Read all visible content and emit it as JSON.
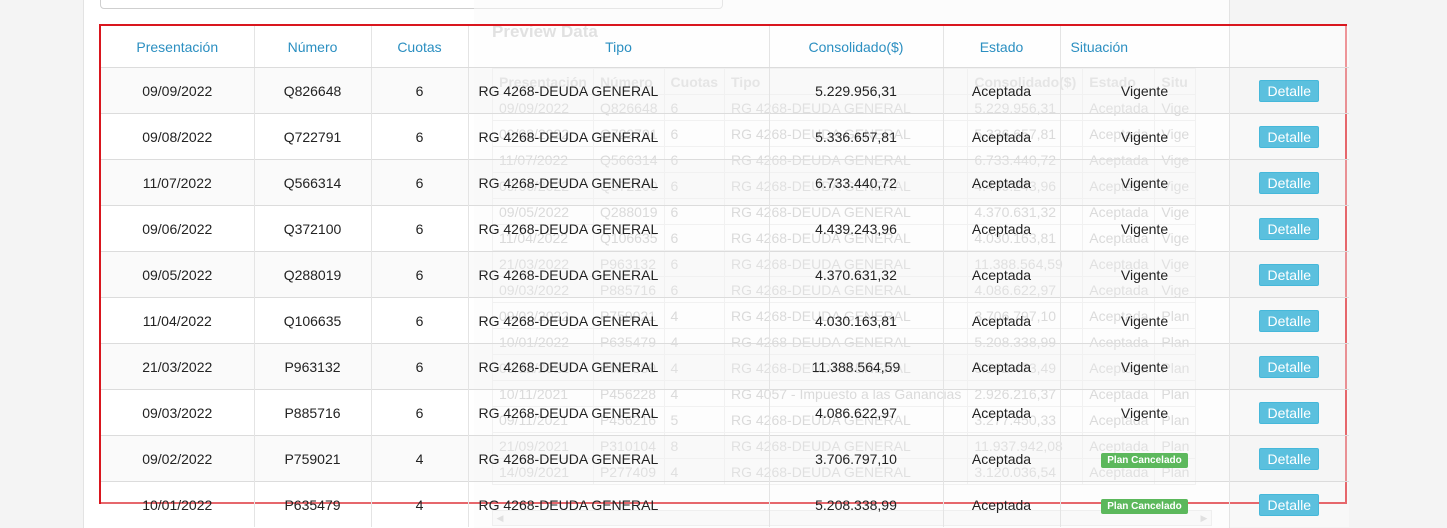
{
  "preview": {
    "title": "Preview Data",
    "headers": [
      "Presentación",
      "Número",
      "Cuotas",
      "Tipo",
      "Consolidado($)",
      "Estado",
      "Situ"
    ],
    "rows": [
      [
        "09/09/2022",
        "Q826648",
        "6",
        "RG 4268-DEUDA GENERAL",
        "5.229.956,31",
        "Aceptada",
        "Vige"
      ],
      [
        "09/08/2022",
        "Q722791",
        "6",
        "RG 4268-DEUDA GENERAL",
        "5.336.657,81",
        "Aceptada",
        "Vige"
      ],
      [
        "11/07/2022",
        "Q566314",
        "6",
        "RG 4268-DEUDA GENERAL",
        "6.733.440,72",
        "Aceptada",
        "Vige"
      ],
      [
        "09/06/2022",
        "Q372100",
        "6",
        "RG 4268-DEUDA GENERAL",
        "4.439.243,96",
        "Aceptada",
        "Vige"
      ],
      [
        "09/05/2022",
        "Q288019",
        "6",
        "RG 4268-DEUDA GENERAL",
        "4.370.631,32",
        "Aceptada",
        "Vige"
      ],
      [
        "11/04/2022",
        "Q106635",
        "6",
        "RG 4268-DEUDA GENERAL",
        "4.030.163,81",
        "Aceptada",
        "Vige"
      ],
      [
        "21/03/2022",
        "P963132",
        "6",
        "RG 4268-DEUDA GENERAL",
        "11.388.564,59",
        "Aceptada",
        "Vige"
      ],
      [
        "09/03/2022",
        "P885716",
        "6",
        "RG 4268-DEUDA GENERAL",
        "4.086.622,97",
        "Aceptada",
        "Vige"
      ],
      [
        "09/02/2022",
        "P759021",
        "4",
        "RG 4268-DEUDA GENERAL",
        "3.706.797,10",
        "Aceptada",
        "Plan"
      ],
      [
        "10/01/2022",
        "P635479",
        "4",
        "RG 4268-DEUDA GENERAL",
        "5.208.338,99",
        "Aceptada",
        "Plan"
      ],
      [
        "09/12/2021",
        "P527389",
        "4",
        "RG 4268-DEUDA GENERAL",
        "3.162.473,49",
        "Aceptada",
        "Plan"
      ],
      [
        "10/11/2021",
        "P456228",
        "4",
        "RG 4057 - Impuesto a las Ganancias",
        "2.926.216,37",
        "Aceptada",
        "Plan"
      ],
      [
        "09/11/2021",
        "P456216",
        "5",
        "RG 4268-DEUDA GENERAL",
        "3.277.450,33",
        "Aceptada",
        "Plan"
      ],
      [
        "21/09/2021",
        "P310104",
        "8",
        "RG 4268-DEUDA GENERAL",
        "11.937.942,08",
        "Aceptada",
        "Plan"
      ],
      [
        "14/09/2021",
        "P277409",
        "4",
        "RG 4268-DEUDA GENERAL",
        "3.120.036,54",
        "Aceptada",
        "Plan"
      ]
    ]
  },
  "table": {
    "headers": {
      "presentacion": "Presentación",
      "numero": "Número",
      "cuotas": "Cuotas",
      "tipo": "Tipo",
      "consolidado": "Consolidado($)",
      "estado": "Estado",
      "situacion": "Situación"
    },
    "detail_label": "Detalle",
    "rows": [
      {
        "presentacion": "09/09/2022",
        "numero": "Q826648",
        "cuotas": "6",
        "tipo": "RG 4268-DEUDA GENERAL",
        "consolidado": "5.229.956,31",
        "estado": "Aceptada",
        "situacion": "Vigente",
        "badge": false
      },
      {
        "presentacion": "09/08/2022",
        "numero": "Q722791",
        "cuotas": "6",
        "tipo": "RG 4268-DEUDA GENERAL",
        "consolidado": "5.336.657,81",
        "estado": "Aceptada",
        "situacion": "Vigente",
        "badge": false
      },
      {
        "presentacion": "11/07/2022",
        "numero": "Q566314",
        "cuotas": "6",
        "tipo": "RG 4268-DEUDA GENERAL",
        "consolidado": "6.733.440,72",
        "estado": "Aceptada",
        "situacion": "Vigente",
        "badge": false
      },
      {
        "presentacion": "09/06/2022",
        "numero": "Q372100",
        "cuotas": "6",
        "tipo": "RG 4268-DEUDA GENERAL",
        "consolidado": "4.439.243,96",
        "estado": "Aceptada",
        "situacion": "Vigente",
        "badge": false
      },
      {
        "presentacion": "09/05/2022",
        "numero": "Q288019",
        "cuotas": "6",
        "tipo": "RG 4268-DEUDA GENERAL",
        "consolidado": "4.370.631,32",
        "estado": "Aceptada",
        "situacion": "Vigente",
        "badge": false
      },
      {
        "presentacion": "11/04/2022",
        "numero": "Q106635",
        "cuotas": "6",
        "tipo": "RG 4268-DEUDA GENERAL",
        "consolidado": "4.030.163,81",
        "estado": "Aceptada",
        "situacion": "Vigente",
        "badge": false
      },
      {
        "presentacion": "21/03/2022",
        "numero": "P963132",
        "cuotas": "6",
        "tipo": "RG 4268-DEUDA GENERAL",
        "consolidado": "11.388.564,59",
        "estado": "Aceptada",
        "situacion": "Vigente",
        "badge": false
      },
      {
        "presentacion": "09/03/2022",
        "numero": "P885716",
        "cuotas": "6",
        "tipo": "RG 4268-DEUDA GENERAL",
        "consolidado": "4.086.622,97",
        "estado": "Aceptada",
        "situacion": "Vigente",
        "badge": false
      },
      {
        "presentacion": "09/02/2022",
        "numero": "P759021",
        "cuotas": "4",
        "tipo": "RG 4268-DEUDA GENERAL",
        "consolidado": "3.706.797,10",
        "estado": "Aceptada",
        "situacion": "Plan Cancelado",
        "badge": true
      },
      {
        "presentacion": "10/01/2022",
        "numero": "P635479",
        "cuotas": "4",
        "tipo": "RG 4268-DEUDA GENERAL",
        "consolidado": "5.208.338,99",
        "estado": "Aceptada",
        "situacion": "Plan Cancelado",
        "badge": true
      }
    ]
  },
  "colors": {
    "header_link": "#2b8fc1",
    "highlight_border": "#d9161e",
    "detail_button": "#5bc0de",
    "badge_success": "#5cb85c"
  }
}
